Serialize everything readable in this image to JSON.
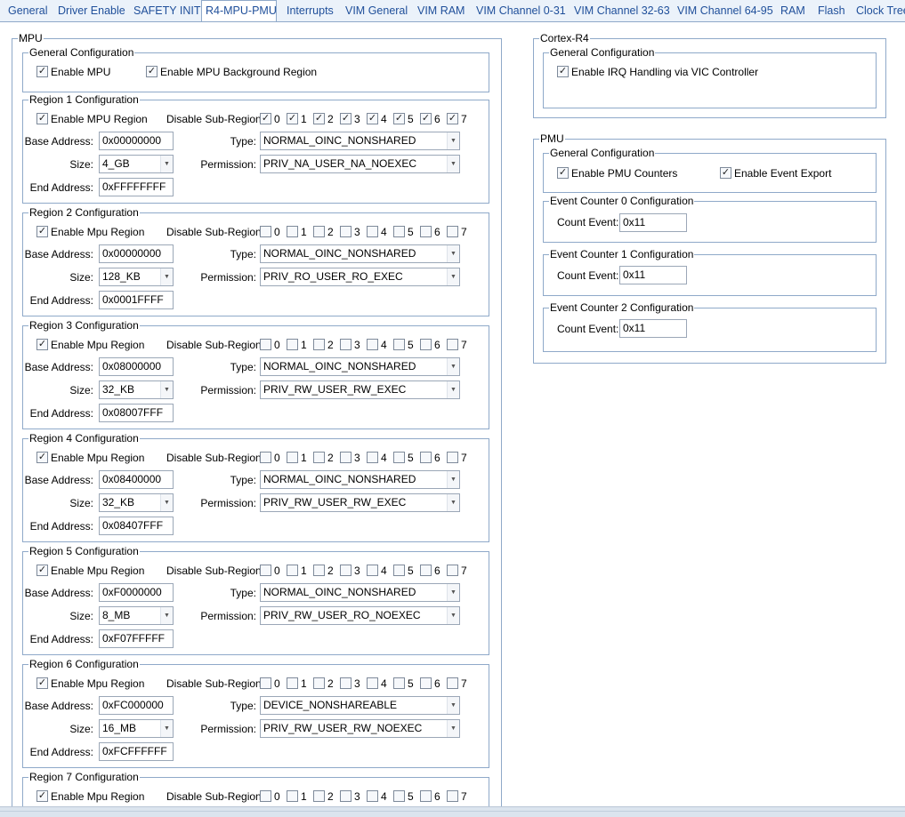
{
  "tabs": [
    "General",
    "Driver Enable",
    "SAFETY INIT",
    "R4-MPU-PMU",
    "Interrupts",
    "VIM General",
    "VIM RAM",
    "VIM Channel 0-31",
    "VIM Channel 32-63",
    "VIM Channel 64-95",
    "RAM",
    "Flash",
    "Clock Tree"
  ],
  "active_tab": "R4-MPU-PMU",
  "mpu": {
    "title": "MPU",
    "general": {
      "title": "General Configuration",
      "enable_mpu": "Enable MPU",
      "enable_bg": "Enable MPU Background Region",
      "enable_mpu_checked": true,
      "enable_bg_checked": true
    },
    "labels": {
      "disable_sub_region": "Disable Sub-Region:",
      "base_address": "Base Address:",
      "type": "Type:",
      "size": "Size:",
      "permission": "Permission:",
      "end_address": "End Address:"
    },
    "sub_region_numbers": [
      "0",
      "1",
      "2",
      "3",
      "4",
      "5",
      "6",
      "7"
    ],
    "regions": [
      {
        "title": "Region 1 Configuration",
        "enable_label": "Enable MPU Region",
        "enabled": true,
        "subregions": [
          true,
          true,
          true,
          true,
          true,
          true,
          true,
          true
        ],
        "base": "0x00000000",
        "type": "NORMAL_OINC_NONSHARED",
        "size": "4_GB",
        "permission": "PRIV_NA_USER_NA_NOEXEC",
        "end": "0xFFFFFFFF"
      },
      {
        "title": "Region 2 Configuration",
        "enable_label": "Enable Mpu Region",
        "enabled": true,
        "subregions": [
          false,
          false,
          false,
          false,
          false,
          false,
          false,
          false
        ],
        "base": "0x00000000",
        "type": "NORMAL_OINC_NONSHARED",
        "size": "128_KB",
        "permission": "PRIV_RO_USER_RO_EXEC",
        "end": "0x0001FFFF"
      },
      {
        "title": "Region 3 Configuration",
        "enable_label": "Enable Mpu Region",
        "enabled": true,
        "subregions": [
          false,
          false,
          false,
          false,
          false,
          false,
          false,
          false
        ],
        "base": "0x08000000",
        "type": "NORMAL_OINC_NONSHARED",
        "size": "32_KB",
        "permission": "PRIV_RW_USER_RW_EXEC",
        "end": "0x08007FFF"
      },
      {
        "title": "Region 4 Configuration",
        "enable_label": "Enable Mpu Region",
        "enabled": true,
        "subregions": [
          false,
          false,
          false,
          false,
          false,
          false,
          false,
          false
        ],
        "base": "0x08400000",
        "type": "NORMAL_OINC_NONSHARED",
        "size": "32_KB",
        "permission": "PRIV_RW_USER_RW_EXEC",
        "end": "0x08407FFF"
      },
      {
        "title": "Region 5 Configuration",
        "enable_label": "Enable Mpu Region",
        "enabled": true,
        "subregions": [
          false,
          false,
          false,
          false,
          false,
          false,
          false,
          false
        ],
        "base": "0xF0000000",
        "type": "NORMAL_OINC_NONSHARED",
        "size": "8_MB",
        "permission": "PRIV_RW_USER_RO_NOEXEC",
        "end": "0xF07FFFFF"
      },
      {
        "title": "Region 6 Configuration",
        "enable_label": "Enable Mpu Region",
        "enabled": true,
        "subregions": [
          false,
          false,
          false,
          false,
          false,
          false,
          false,
          false
        ],
        "base": "0xFC000000",
        "type": "DEVICE_NONSHAREABLE",
        "size": "16_MB",
        "permission": "PRIV_RW_USER_RW_NOEXEC",
        "end": "0xFCFFFFFF"
      },
      {
        "title": "Region 7 Configuration",
        "enable_label": "Enable Mpu Region",
        "enabled": true,
        "subregions": [
          false,
          false,
          false,
          false,
          false,
          false,
          false,
          false
        ],
        "base": "",
        "type": "",
        "size": "",
        "permission": "",
        "end": ""
      }
    ]
  },
  "cortex": {
    "title": "Cortex-R4",
    "general": {
      "title": "General Configuration",
      "irq_label": "Enable IRQ Handling via VIC Controller",
      "irq_checked": true
    }
  },
  "pmu": {
    "title": "PMU",
    "general": {
      "title": "General Configuration",
      "counters_label": "Enable PMU Counters",
      "export_label": "Enable Event Export",
      "counters_checked": true,
      "export_checked": true
    },
    "count_event_label": "Count Event:",
    "counters": [
      {
        "title": "Event Counter 0 Configuration",
        "value": "0x11"
      },
      {
        "title": "Event Counter 1 Configuration",
        "value": "0x11"
      },
      {
        "title": "Event Counter 2 Configuration",
        "value": "0x11"
      }
    ]
  }
}
